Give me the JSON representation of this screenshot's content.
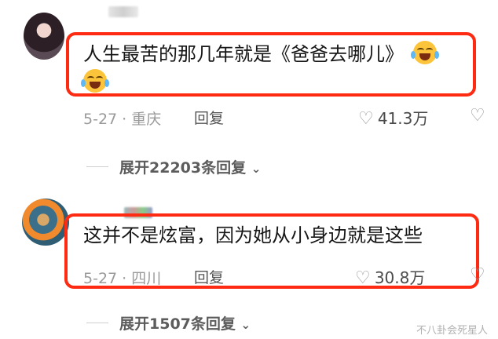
{
  "comments": [
    {
      "text": "人生最苦的那几年就是《爸爸去哪儿》",
      "emoji_name": "crying-laughing-emoji",
      "date": "5-27",
      "location": "重庆",
      "reply_label": "回复",
      "likes": "41.3万",
      "expand_label": "展开22203条回复"
    },
    {
      "text": "这并不是炫富，因为她从小身边就是这些",
      "date": "5-27",
      "location": "四川",
      "reply_label": "回复",
      "likes": "30.8万",
      "expand_label": "展开1507条回复"
    }
  ],
  "watermark": "不八卦会死星人",
  "colors": {
    "highlight": "#ff2a12",
    "emoji": "#fbc43a",
    "meta": "#9a9a9a"
  }
}
